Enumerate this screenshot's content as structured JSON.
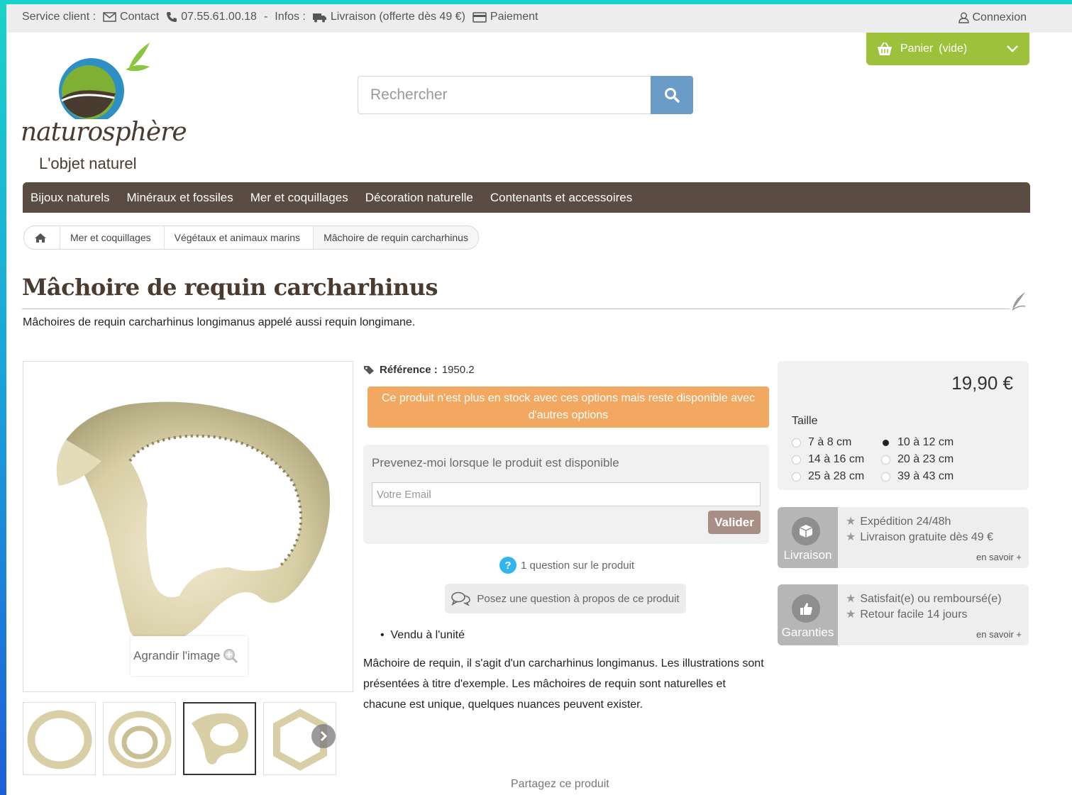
{
  "topbar": {
    "service_label": "Service client :",
    "contact": "Contact",
    "phone": "07.55.61.00.18",
    "separator": "-",
    "infos_label": "Infos :",
    "delivery": "Livraison (offerte dès 49 €)",
    "payment": "Paiement",
    "login": "Connexion"
  },
  "cart": {
    "label": "Panier",
    "status": "(vide)"
  },
  "logo": {
    "word": "naturosphère",
    "tagline": "L'objet naturel"
  },
  "search": {
    "placeholder": "Rechercher"
  },
  "nav": {
    "items": [
      "Bijoux naturels",
      "Minéraux et fossiles",
      "Mer et coquillages",
      "Décoration naturelle",
      "Contenants et accessoires"
    ]
  },
  "breadcrumb": {
    "items": [
      "Mer et coquillages",
      "Végétaux et animaux marins",
      "Mâchoire de requin carcharhinus"
    ]
  },
  "product": {
    "title": "Mâchoire de requin carcharhinus",
    "intro": "Mâchoires de requin carcharhinus longimanus appelé aussi requin longimane.",
    "zoom_label": "Agrandir l'image",
    "reference_label": "Référence :",
    "reference_value": "1950.2",
    "stock_alert": "Ce produit n'est plus en stock avec ces options mais reste disponible avec d'autres options",
    "notify_title": "Prevenez-moi lorsque le produit est disponible",
    "email_placeholder": "Votre Email",
    "submit_label": "Valider",
    "question_count": "1 question sur le produit",
    "ask_button": "Posez une question à propos de ce produit",
    "bullet": "Vendu à l'unité",
    "description": "Mâchoire de requin, il s'agit d'un carcharhinus longimanus. Les illustrations sont présentées à titre d'exemple. Les mâchoires de requin sont naturelles et chacune est unique, quelques nuances peuvent exister.",
    "share": "Partagez ce produit"
  },
  "pricing": {
    "price": "19,90 €",
    "size_label": "Taille",
    "options": [
      {
        "label": "7 à 8 cm",
        "selected": false
      },
      {
        "label": "10 à 12 cm",
        "selected": true
      },
      {
        "label": "14 à 16 cm",
        "selected": false
      },
      {
        "label": "20 à 23 cm",
        "selected": false
      },
      {
        "label": "25 à 28 cm",
        "selected": false
      },
      {
        "label": "39 à 43 cm",
        "selected": false
      }
    ]
  },
  "delivery_box": {
    "title": "Livraison",
    "line1": "Expédition 24/48h",
    "line2": "Livraison gratuite dès 49 €",
    "more": "en savoir +"
  },
  "guarantee_box": {
    "title": "Garanties",
    "line1": "Satisfait(e) ou remboursé(e)",
    "line2": "Retour facile 14 jours",
    "more": "en savoir +"
  },
  "colors": {
    "accent_green": "#9ec13b",
    "nav_brown": "#5a4c42",
    "alert_orange": "#f3a862",
    "search_blue": "#6b9cc7"
  }
}
